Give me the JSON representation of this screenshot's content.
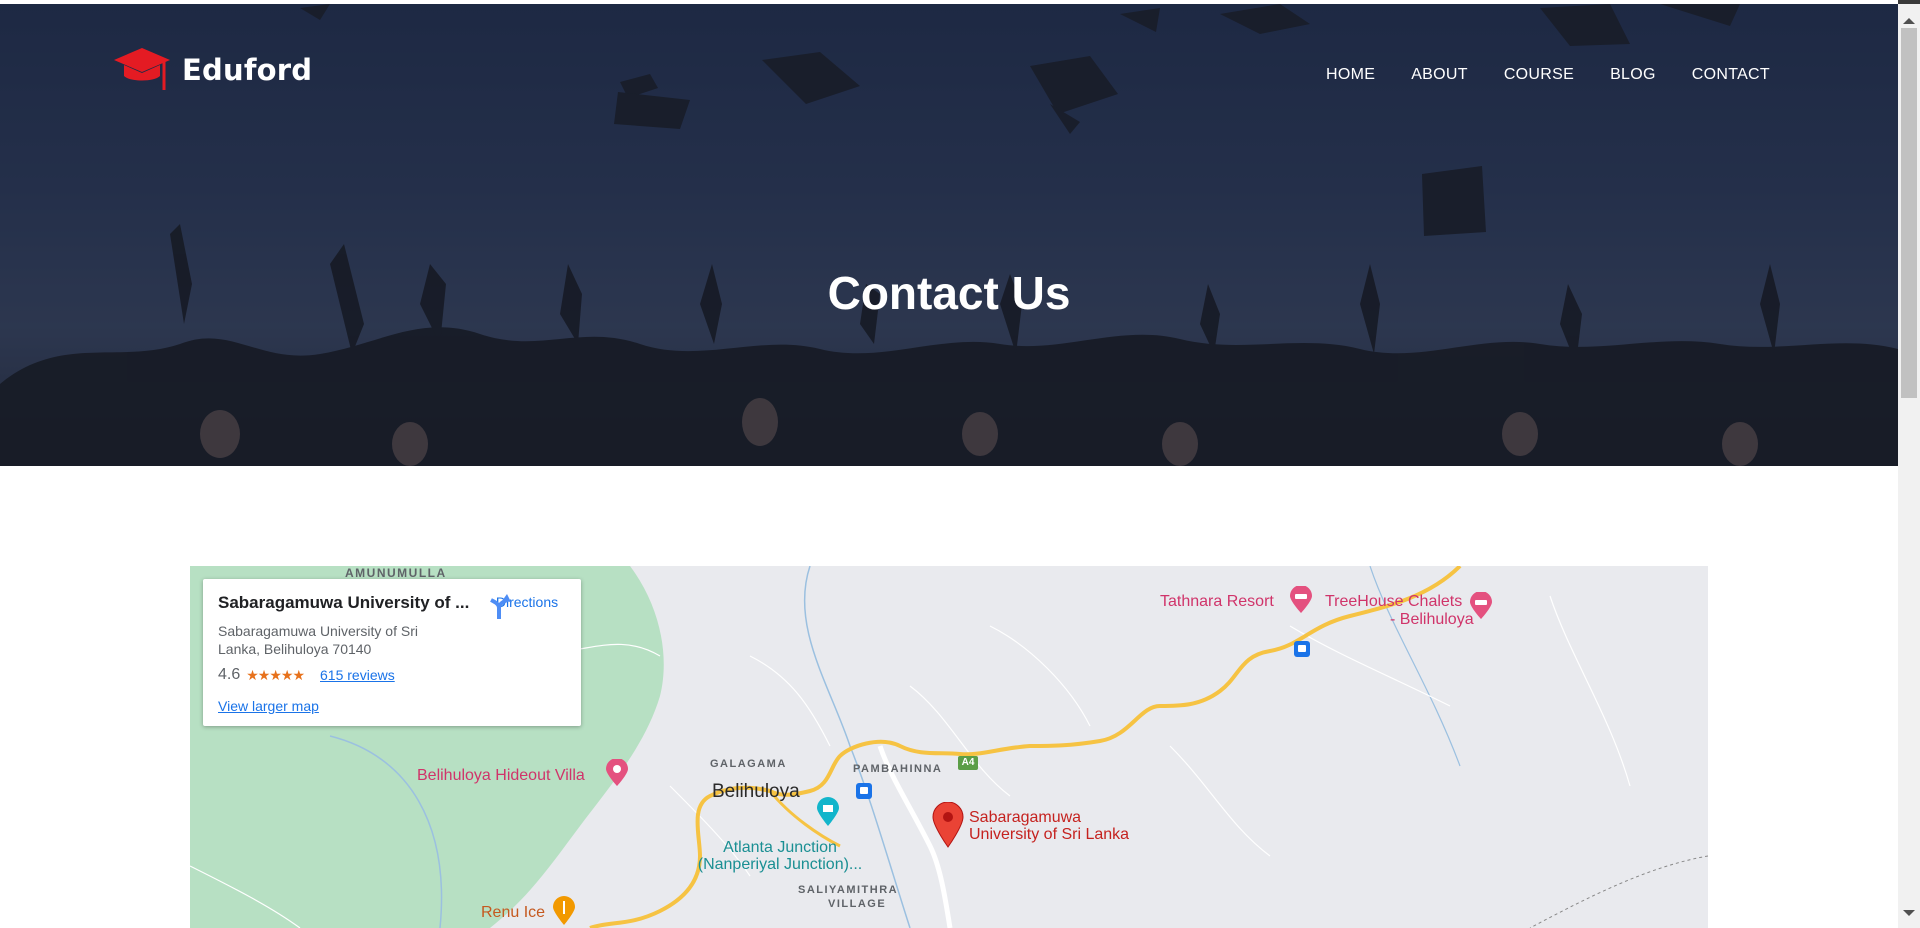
{
  "brand": {
    "name": "Eduford",
    "accent": "#e41b23"
  },
  "nav": {
    "items": [
      "HOME",
      "ABOUT",
      "COURSE",
      "BLOG",
      "CONTACT"
    ]
  },
  "hero": {
    "title": "Contact Us"
  },
  "map": {
    "card": {
      "title": "Sabaragamuwa University of ...",
      "address": "Sabaragamuwa University of Sri Lanka, Belihuloya 70140",
      "rating": "4.6",
      "reviews": "615 reviews",
      "larger_map": "View larger map",
      "directions": "Directions"
    },
    "labels": {
      "amunumulla": "AMUNUMULLA",
      "tathnara": "Tathnara Resort",
      "treehouse_1": "TreeHouse Chalets",
      "treehouse_2": "- Belihuloya",
      "hideout": "Belihuloya Hideout Villa",
      "galagama": "GALAGAMA",
      "pambahinna": "PAMBAHINNA",
      "belihuloya": "Belihuloya",
      "atlanta_1": "Atlanta Junction",
      "atlanta_2": "(Nanperiyal Junction)...",
      "saliyamithra_1": "SALIYAMITHRA",
      "saliyamithra_2": "VILLAGE",
      "university_1": "Sabaragamuwa",
      "university_2": "University of Sri Lanka",
      "renu": "Renu Ice",
      "road": "A4"
    }
  }
}
